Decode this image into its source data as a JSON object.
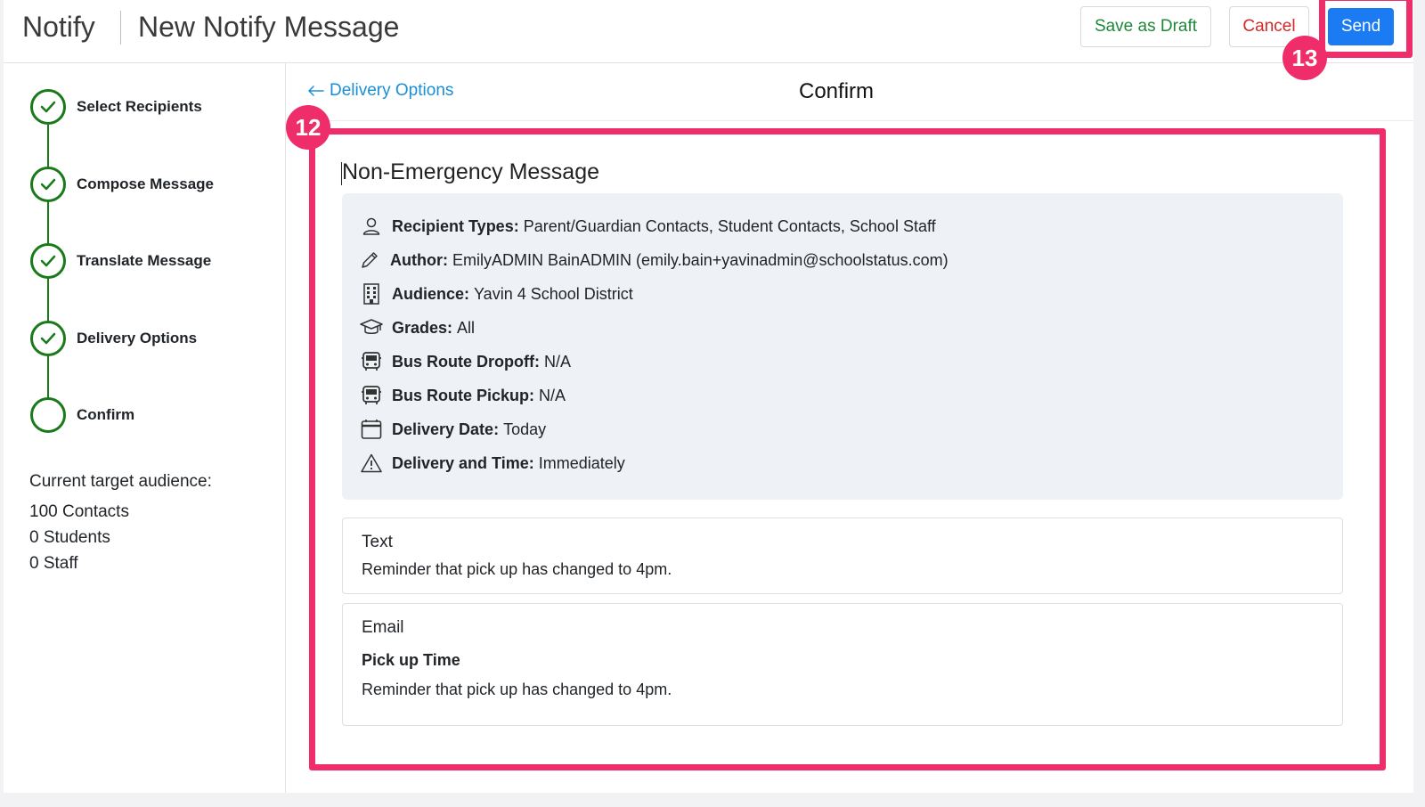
{
  "header": {
    "brand": "Notify",
    "title": "New Notify Message",
    "save_draft": "Save as Draft",
    "cancel": "Cancel",
    "send": "Send"
  },
  "steps": [
    {
      "label": "Select Recipients",
      "done": true
    },
    {
      "label": "Compose Message",
      "done": true
    },
    {
      "label": "Translate Message",
      "done": true
    },
    {
      "label": "Delivery Options",
      "done": true
    },
    {
      "label": "Confirm",
      "done": false
    }
  ],
  "audience": {
    "title": "Current target audience:",
    "lines": [
      "100 Contacts",
      "0 Students",
      "0 Staff"
    ]
  },
  "main": {
    "back_label": "Delivery Options",
    "title": "Confirm",
    "message_type": "Non-Emergency Message"
  },
  "summary": [
    {
      "icon": "person-icon",
      "label": "Recipient Types:",
      "value": "Parent/Guardian Contacts, Student Contacts, School Staff"
    },
    {
      "icon": "pencil-icon",
      "label": "Author:",
      "value": "EmilyADMIN BainADMIN (emily.bain+yavinadmin@schoolstatus.com)"
    },
    {
      "icon": "building-icon",
      "label": "Audience:",
      "value": "Yavin 4 School District"
    },
    {
      "icon": "graduation-cap-icon",
      "label": "Grades:",
      "value": "All"
    },
    {
      "icon": "bus-icon",
      "label": "Bus Route Dropoff:",
      "value": "N/A"
    },
    {
      "icon": "bus-icon",
      "label": "Bus Route Pickup:",
      "value": "N/A"
    },
    {
      "icon": "calendar-icon",
      "label": "Delivery Date:",
      "value": "Today"
    },
    {
      "icon": "warning-icon",
      "label": "Delivery and Time:",
      "value": "Immediately"
    }
  ],
  "text_card": {
    "title": "Text",
    "body": "Reminder that pick up has changed to 4pm."
  },
  "email_card": {
    "title": "Email",
    "subject": "Pick up Time",
    "body": "Reminder that pick up has changed to 4pm."
  },
  "annotations": {
    "badge_content": "12",
    "badge_send": "13",
    "color": "#ef2d6a"
  },
  "colors": {
    "step_green": "#1a7a1a",
    "primary_blue": "#1a7bf2",
    "link_blue": "#1a8fd6",
    "draft_green": "#1d8a3a",
    "cancel_red": "#d62828",
    "summary_bg": "#eef1f5"
  }
}
